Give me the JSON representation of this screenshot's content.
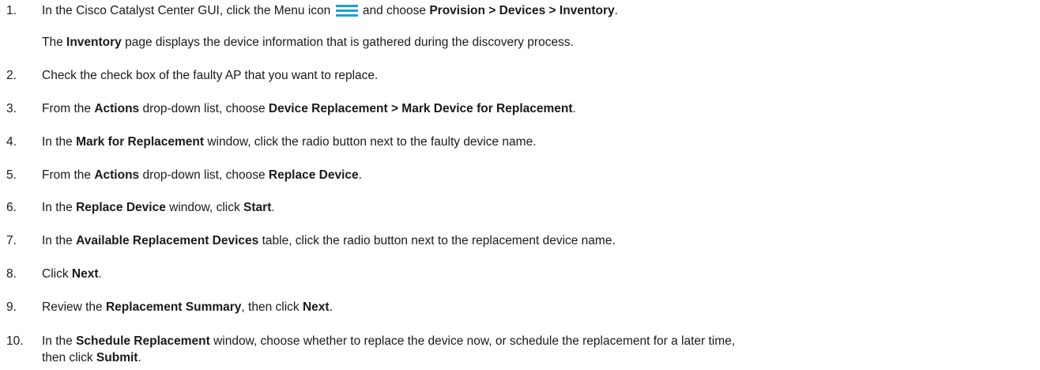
{
  "steps": [
    {
      "num": "1.",
      "parts": [
        {
          "t": "In the Cisco Catalyst Center GUI, click the Menu icon "
        },
        {
          "icon": "menu-icon"
        },
        {
          "t": " and choose "
        },
        {
          "b": "Provision > Devices > Inventory"
        },
        {
          "t": "."
        }
      ],
      "sub": [
        {
          "t": "The "
        },
        {
          "b": "Inventory"
        },
        {
          "t": " page displays the device information that is gathered during the discovery process."
        }
      ]
    },
    {
      "num": "2.",
      "parts": [
        {
          "t": "Check the check box of the faulty AP that you want to replace."
        }
      ]
    },
    {
      "num": "3.",
      "parts": [
        {
          "t": "From the "
        },
        {
          "b": "Actions"
        },
        {
          "t": " drop-down list, choose "
        },
        {
          "b": "Device Replacement > Mark Device for Replacement"
        },
        {
          "t": "."
        }
      ]
    },
    {
      "num": "4.",
      "parts": [
        {
          "t": "In the "
        },
        {
          "b": "Mark for Replacement"
        },
        {
          "t": " window, click the radio button next to the faulty device name."
        }
      ]
    },
    {
      "num": "5.",
      "parts": [
        {
          "t": "From the "
        },
        {
          "b": "Actions"
        },
        {
          "t": " drop-down list, choose "
        },
        {
          "b": "Replace Device"
        },
        {
          "t": "."
        }
      ]
    },
    {
      "num": "6.",
      "parts": [
        {
          "t": "In the "
        },
        {
          "b": "Replace Device"
        },
        {
          "t": " window, click "
        },
        {
          "b": "Start"
        },
        {
          "t": "."
        }
      ]
    },
    {
      "num": "7.",
      "parts": [
        {
          "t": "In the "
        },
        {
          "b": "Available Replacement Devices"
        },
        {
          "t": " table, click the radio button next to the replacement device name."
        }
      ]
    },
    {
      "num": "8.",
      "parts": [
        {
          "t": "Click "
        },
        {
          "b": "Next"
        },
        {
          "t": "."
        }
      ]
    },
    {
      "num": "9.",
      "parts": [
        {
          "t": "Review the "
        },
        {
          "b": "Replacement Summary"
        },
        {
          "t": ", then click "
        },
        {
          "b": "Next"
        },
        {
          "t": "."
        }
      ]
    },
    {
      "num": "10.",
      "parts": [
        {
          "t": "In the "
        },
        {
          "b": "Schedule Replacement"
        },
        {
          "t": " window, choose whether to replace the device now, or schedule the replacement for a later time,"
        }
      ],
      "sub": [
        {
          "t": "then click "
        },
        {
          "b": "Submit"
        },
        {
          "t": "."
        }
      ]
    }
  ],
  "colors": {
    "text": "#1a1a1a",
    "menu_icon": "#1ba0d7"
  }
}
